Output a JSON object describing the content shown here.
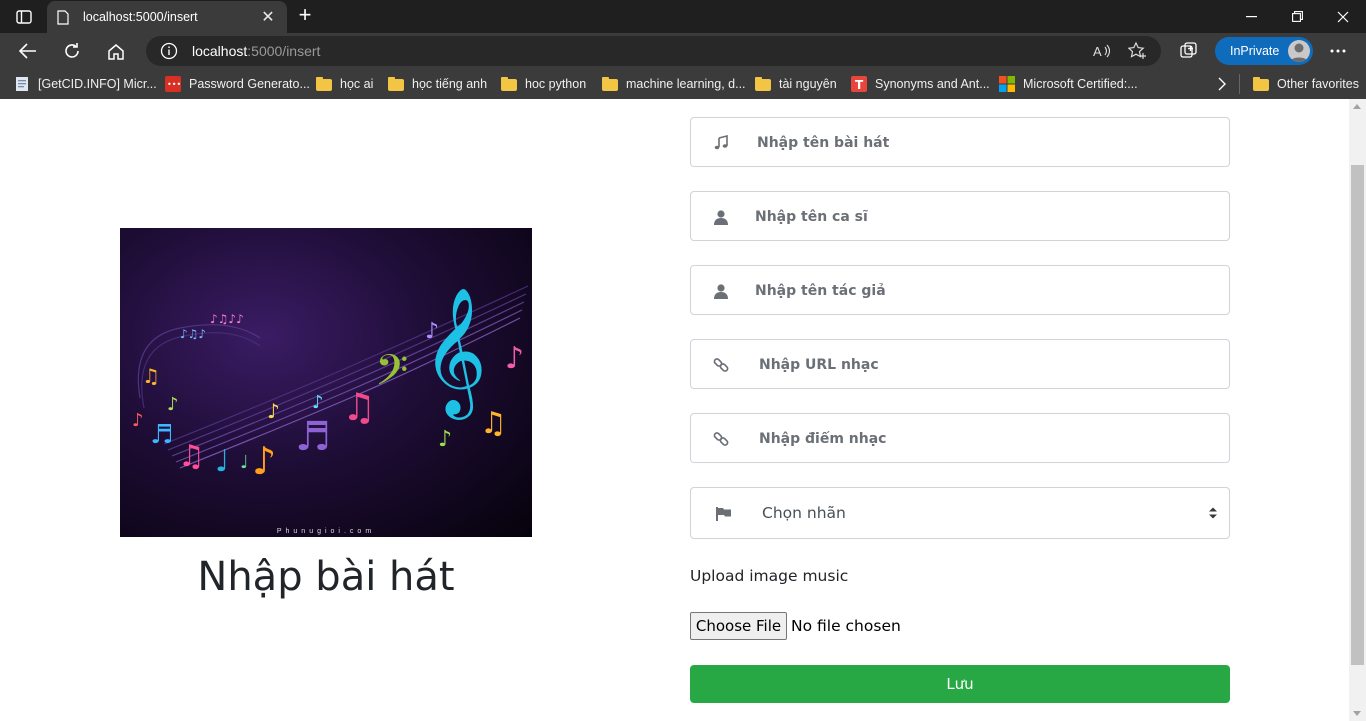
{
  "browser": {
    "tab_title": "localhost:5000/insert",
    "url_host": "localhost",
    "url_rest": ":5000/insert",
    "inprivate_label": "InPrivate"
  },
  "favorites": [
    {
      "label": "[GetCID.INFO] Micr...",
      "icon": "page-icon"
    },
    {
      "label": "Password Generato...",
      "icon": "password-icon"
    },
    {
      "label": "học ai",
      "icon": "folder-icon"
    },
    {
      "label": "học tiếng anh",
      "icon": "folder-icon"
    },
    {
      "label": "hoc python",
      "icon": "folder-icon"
    },
    {
      "label": "machine learning, d...",
      "icon": "folder-icon"
    },
    {
      "label": "tài nguyên",
      "icon": "folder-icon"
    },
    {
      "label": "Synonyms and Ant...",
      "icon": "thesaurus-icon"
    },
    {
      "label": "Microsoft Certified:...",
      "icon": "microsoft-icon"
    }
  ],
  "other_favorites": "Other favorites",
  "page": {
    "title": "Nhập bài hát",
    "poster_caption": "Phunugioi.com",
    "fields": {
      "song_name": {
        "placeholder": "Nhập tên bài hát",
        "icon": "music-note-icon"
      },
      "singer": {
        "placeholder": "Nhập tên ca sĩ",
        "icon": "user-icon"
      },
      "author": {
        "placeholder": "Nhập tên tác giả",
        "icon": "user-icon"
      },
      "music_url": {
        "placeholder": "Nhập URL nhạc",
        "icon": "link-icon"
      },
      "music_score": {
        "placeholder": "Nhập điểm nhạc",
        "icon": "link-icon"
      },
      "label_select": {
        "selected": "Chọn nhãn",
        "icon": "flag-icon"
      }
    },
    "upload_label": "Upload image music",
    "choose_file": "Choose File",
    "file_status": "No file chosen",
    "save": "Lưu"
  },
  "colors": {
    "save_button": "#28a745",
    "inprivate_badge": "#0f6cbd",
    "chrome_dark": "#3b3b3b"
  }
}
